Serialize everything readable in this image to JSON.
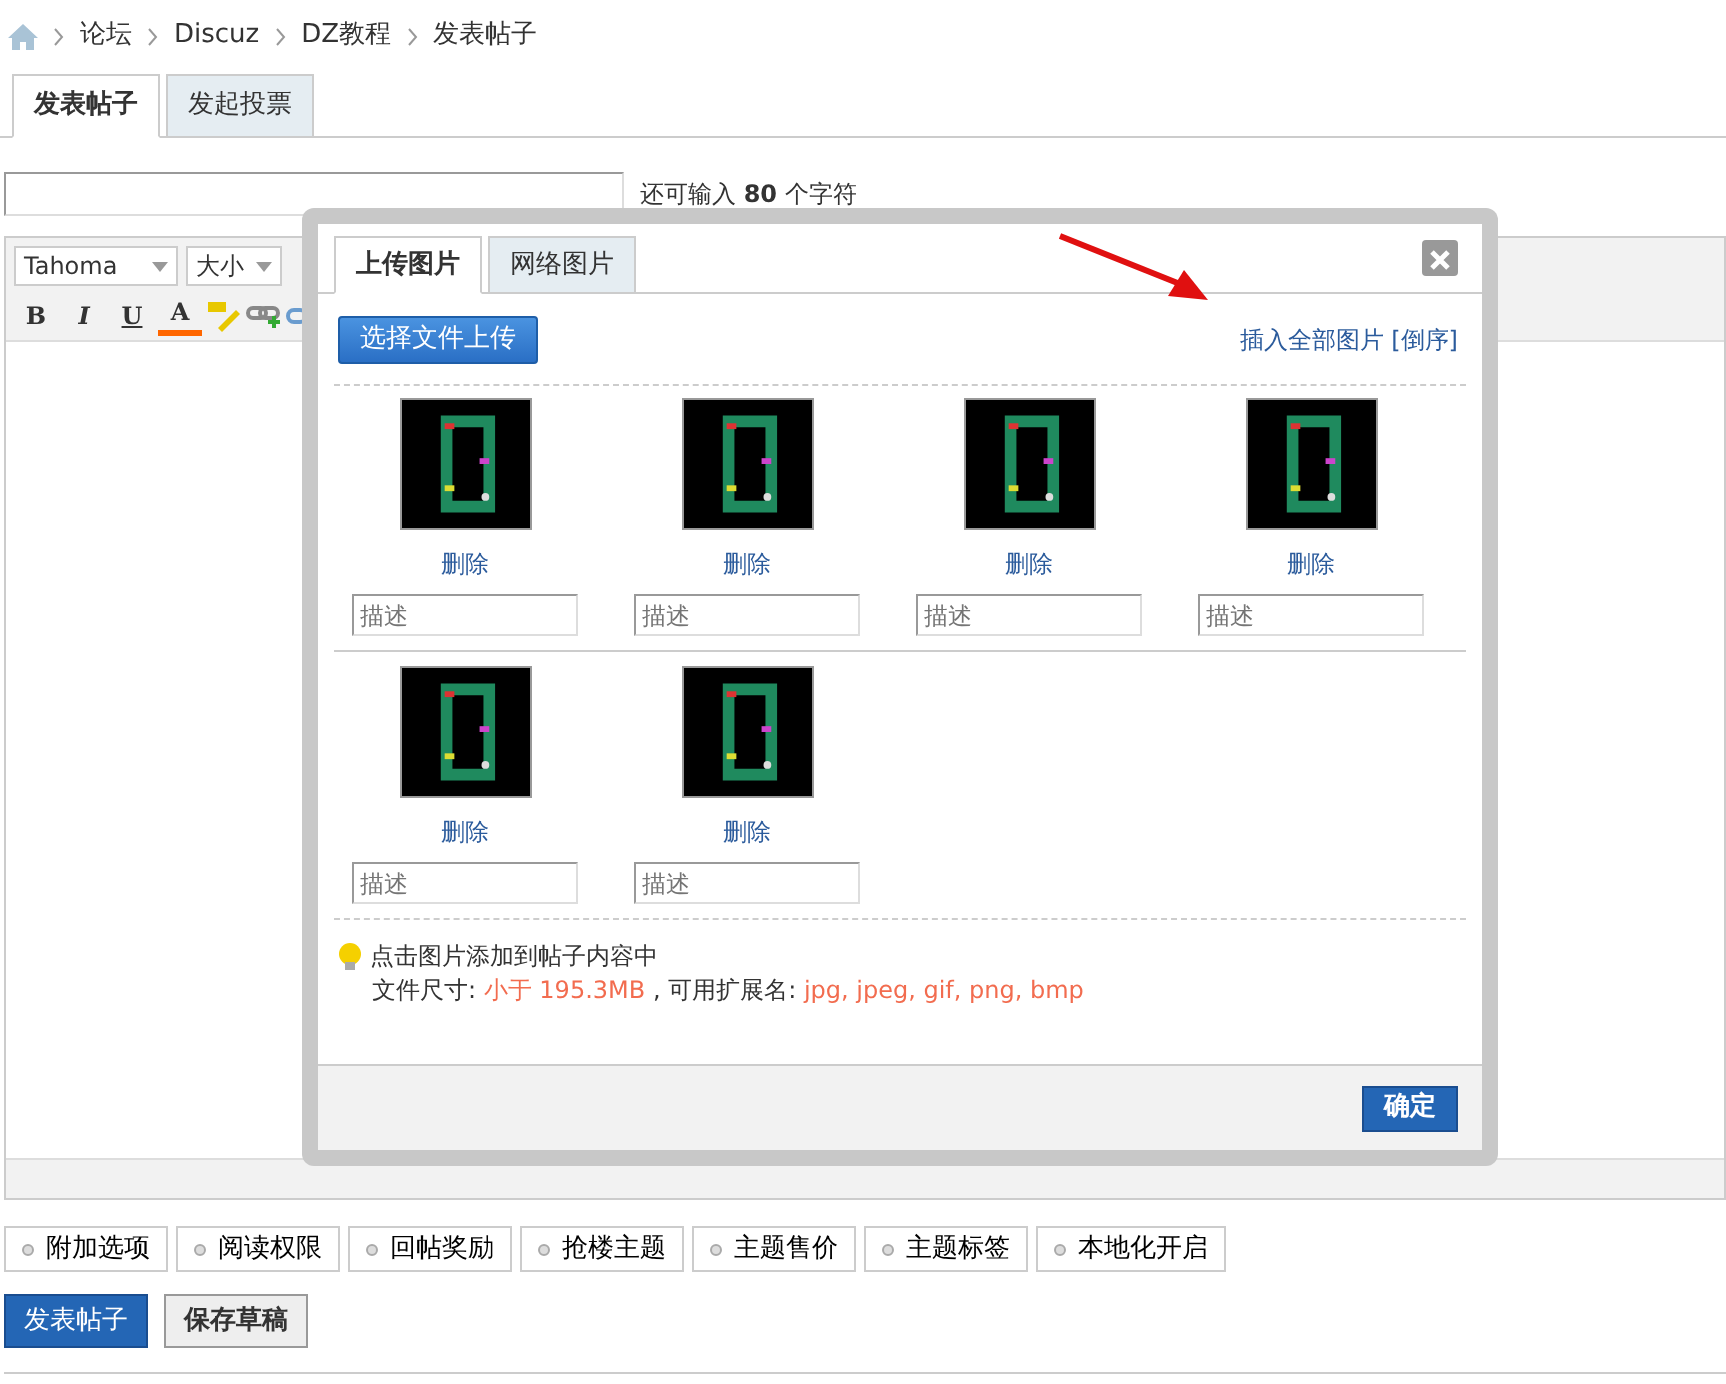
{
  "breadcrumb": [
    "论坛",
    "Discuz",
    "DZ教程",
    "发表帖子"
  ],
  "tabs": [
    {
      "label": "发表帖子",
      "selected": true
    },
    {
      "label": "发起投票",
      "selected": false
    }
  ],
  "subject": {
    "hint": "还可输入 **80** 个字符"
  },
  "editor": {
    "font": "Tahoma",
    "size": "大小",
    "format_buttons": [
      "B",
      "I",
      "U",
      "A"
    ]
  },
  "dialog": {
    "tabs": [
      {
        "label": "上传图片",
        "selected": true
      },
      {
        "label": "网络图片",
        "selected": false
      }
    ],
    "upload_button": "选择文件上传",
    "insert_all": "插入全部图片 [倒序]",
    "images": [
      {
        "kind": "picture",
        "delete": "删除",
        "placeholder": "描述"
      },
      {
        "kind": "picture",
        "delete": "删除",
        "placeholder": "描述"
      },
      {
        "kind": "picture",
        "delete": "删除",
        "placeholder": "描述"
      },
      {
        "kind": "picture",
        "delete": "删除",
        "placeholder": "描述"
      },
      {
        "kind": "picture",
        "delete": "删除",
        "placeholder": "描述"
      },
      {
        "kind": "picture",
        "delete": "删除",
        "placeholder": "描述"
      }
    ],
    "tip": "点击图片添加到帖子内容中",
    "limits": [
      {
        "text": "文件尺寸: ",
        "accent": false
      },
      {
        "text": "小于 195.3MB",
        "accent": true
      },
      {
        "text": " , 可用扩展名: ",
        "accent": false
      },
      {
        "text": "jpg, jpeg, gif, png, bmp",
        "accent": true
      }
    ],
    "ok": "确定"
  },
  "options": [
    "附加选项",
    "阅读权限",
    "回帖奖励",
    "抢楼主题",
    "主题售价",
    "主题标签",
    "本地化开启"
  ],
  "actions": [
    {
      "label": "发表帖子",
      "kind": "primary"
    },
    {
      "label": "保存草稿",
      "kind": "secondary"
    }
  ]
}
